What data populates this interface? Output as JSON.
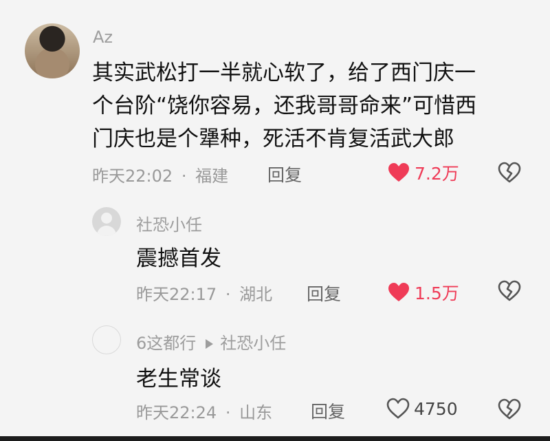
{
  "comments": [
    {
      "name": "Az",
      "lines": [
        "其实武松打一半就心软了，给了西门庆一",
        "个台阶“饶你容易，还我哥哥命来”可惜西",
        "门庆也是个犟种，死活不肯复活武大郎"
      ],
      "time": "昨天22:02",
      "location": "福建",
      "reply_label": "回复",
      "likes": "7.2万",
      "liked": true
    },
    {
      "name": "社恐小任",
      "text": "震撼首发",
      "time": "昨天22:17",
      "location": "湖北",
      "reply_label": "回复",
      "likes": "1.5万",
      "liked": true
    },
    {
      "name": "6这都行",
      "reply_to": "社恐小任",
      "text": "老生常谈",
      "time": "昨天22:24",
      "location": "山东",
      "reply_label": "回复",
      "likes": "4750",
      "liked": false
    }
  ],
  "colors": {
    "like": "#ef3b57",
    "meta": "#999999",
    "text": "#111111"
  }
}
